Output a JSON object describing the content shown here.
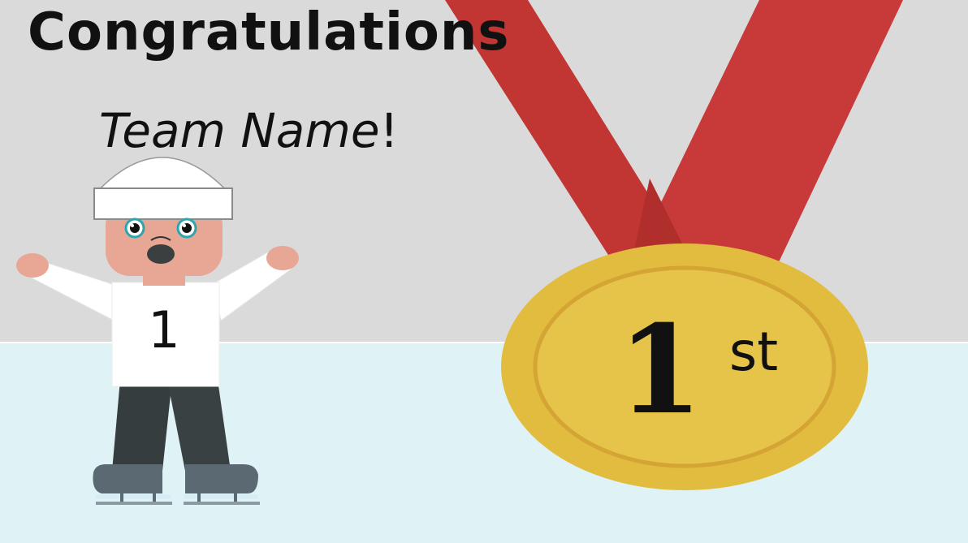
{
  "greeting": {
    "heading": "Congratulations",
    "team_name": "Team Name",
    "punctuation": "!"
  },
  "skater": {
    "jersey_number": "1"
  },
  "medal": {
    "place_number": "1",
    "place_suffix": "st"
  },
  "colors": {
    "wall": "#dadada",
    "ice": "#dff2f6",
    "ribbon": "#c13532",
    "medal_outer": "#e2bc3e",
    "medal_inner": "#e6c44a",
    "medal_ring": "#d6a838"
  }
}
